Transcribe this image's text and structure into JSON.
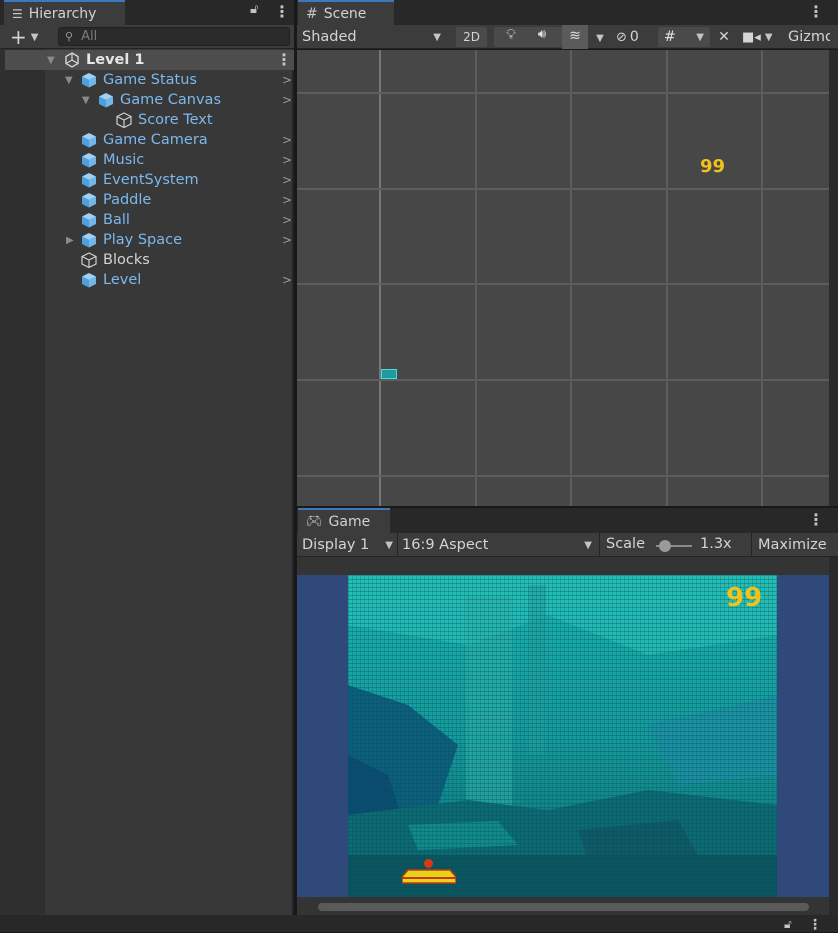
{
  "hierarchy": {
    "tab_label": "Hierarchy",
    "search_placeholder": "All",
    "scene_name": "Level 1",
    "items": [
      {
        "label": "Game Status"
      },
      {
        "label": "Game Canvas"
      },
      {
        "label": "Score Text"
      },
      {
        "label": "Game Camera"
      },
      {
        "label": "Music"
      },
      {
        "label": "EventSystem"
      },
      {
        "label": "Paddle"
      },
      {
        "label": "Ball"
      },
      {
        "label": "Play Space"
      },
      {
        "label": "Blocks"
      },
      {
        "label": "Level"
      }
    ]
  },
  "scene": {
    "tab_label": "Scene",
    "shading_mode": "Shaded",
    "mode_2d": "2D",
    "hidden_count": "0",
    "gizmos_label": "Gizmos",
    "score_text": "99"
  },
  "game": {
    "tab_label": "Game",
    "display": "Display 1",
    "aspect": "16:9 Aspect",
    "scale_label": "Scale",
    "scale_value": "1.3x",
    "scale_fraction": 0.1,
    "maximize_label": "Maximize",
    "score_text": "99"
  },
  "colors": {
    "accent": "#3a79bb",
    "hierarchy_link": "#7cb8ee",
    "score_yellow": "#f1c21b",
    "game_letterbox": "#2f4a7a",
    "panel_bg": "#383838"
  }
}
